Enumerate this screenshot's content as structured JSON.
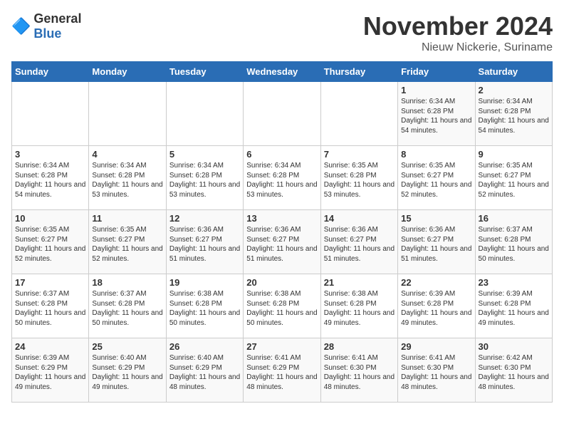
{
  "logo": {
    "text_general": "General",
    "text_blue": "Blue"
  },
  "title": "November 2024",
  "subtitle": "Nieuw Nickerie, Suriname",
  "days_of_week": [
    "Sunday",
    "Monday",
    "Tuesday",
    "Wednesday",
    "Thursday",
    "Friday",
    "Saturday"
  ],
  "weeks": [
    [
      {
        "day": "",
        "detail": ""
      },
      {
        "day": "",
        "detail": ""
      },
      {
        "day": "",
        "detail": ""
      },
      {
        "day": "",
        "detail": ""
      },
      {
        "day": "",
        "detail": ""
      },
      {
        "day": "1",
        "detail": "Sunrise: 6:34 AM\nSunset: 6:28 PM\nDaylight: 11 hours and 54 minutes."
      },
      {
        "day": "2",
        "detail": "Sunrise: 6:34 AM\nSunset: 6:28 PM\nDaylight: 11 hours and 54 minutes."
      }
    ],
    [
      {
        "day": "3",
        "detail": "Sunrise: 6:34 AM\nSunset: 6:28 PM\nDaylight: 11 hours and 54 minutes."
      },
      {
        "day": "4",
        "detail": "Sunrise: 6:34 AM\nSunset: 6:28 PM\nDaylight: 11 hours and 53 minutes."
      },
      {
        "day": "5",
        "detail": "Sunrise: 6:34 AM\nSunset: 6:28 PM\nDaylight: 11 hours and 53 minutes."
      },
      {
        "day": "6",
        "detail": "Sunrise: 6:34 AM\nSunset: 6:28 PM\nDaylight: 11 hours and 53 minutes."
      },
      {
        "day": "7",
        "detail": "Sunrise: 6:35 AM\nSunset: 6:28 PM\nDaylight: 11 hours and 53 minutes."
      },
      {
        "day": "8",
        "detail": "Sunrise: 6:35 AM\nSunset: 6:27 PM\nDaylight: 11 hours and 52 minutes."
      },
      {
        "day": "9",
        "detail": "Sunrise: 6:35 AM\nSunset: 6:27 PM\nDaylight: 11 hours and 52 minutes."
      }
    ],
    [
      {
        "day": "10",
        "detail": "Sunrise: 6:35 AM\nSunset: 6:27 PM\nDaylight: 11 hours and 52 minutes."
      },
      {
        "day": "11",
        "detail": "Sunrise: 6:35 AM\nSunset: 6:27 PM\nDaylight: 11 hours and 52 minutes."
      },
      {
        "day": "12",
        "detail": "Sunrise: 6:36 AM\nSunset: 6:27 PM\nDaylight: 11 hours and 51 minutes."
      },
      {
        "day": "13",
        "detail": "Sunrise: 6:36 AM\nSunset: 6:27 PM\nDaylight: 11 hours and 51 minutes."
      },
      {
        "day": "14",
        "detail": "Sunrise: 6:36 AM\nSunset: 6:27 PM\nDaylight: 11 hours and 51 minutes."
      },
      {
        "day": "15",
        "detail": "Sunrise: 6:36 AM\nSunset: 6:27 PM\nDaylight: 11 hours and 51 minutes."
      },
      {
        "day": "16",
        "detail": "Sunrise: 6:37 AM\nSunset: 6:28 PM\nDaylight: 11 hours and 50 minutes."
      }
    ],
    [
      {
        "day": "17",
        "detail": "Sunrise: 6:37 AM\nSunset: 6:28 PM\nDaylight: 11 hours and 50 minutes."
      },
      {
        "day": "18",
        "detail": "Sunrise: 6:37 AM\nSunset: 6:28 PM\nDaylight: 11 hours and 50 minutes."
      },
      {
        "day": "19",
        "detail": "Sunrise: 6:38 AM\nSunset: 6:28 PM\nDaylight: 11 hours and 50 minutes."
      },
      {
        "day": "20",
        "detail": "Sunrise: 6:38 AM\nSunset: 6:28 PM\nDaylight: 11 hours and 50 minutes."
      },
      {
        "day": "21",
        "detail": "Sunrise: 6:38 AM\nSunset: 6:28 PM\nDaylight: 11 hours and 49 minutes."
      },
      {
        "day": "22",
        "detail": "Sunrise: 6:39 AM\nSunset: 6:28 PM\nDaylight: 11 hours and 49 minutes."
      },
      {
        "day": "23",
        "detail": "Sunrise: 6:39 AM\nSunset: 6:28 PM\nDaylight: 11 hours and 49 minutes."
      }
    ],
    [
      {
        "day": "24",
        "detail": "Sunrise: 6:39 AM\nSunset: 6:29 PM\nDaylight: 11 hours and 49 minutes."
      },
      {
        "day": "25",
        "detail": "Sunrise: 6:40 AM\nSunset: 6:29 PM\nDaylight: 11 hours and 49 minutes."
      },
      {
        "day": "26",
        "detail": "Sunrise: 6:40 AM\nSunset: 6:29 PM\nDaylight: 11 hours and 48 minutes."
      },
      {
        "day": "27",
        "detail": "Sunrise: 6:41 AM\nSunset: 6:29 PM\nDaylight: 11 hours and 48 minutes."
      },
      {
        "day": "28",
        "detail": "Sunrise: 6:41 AM\nSunset: 6:30 PM\nDaylight: 11 hours and 48 minutes."
      },
      {
        "day": "29",
        "detail": "Sunrise: 6:41 AM\nSunset: 6:30 PM\nDaylight: 11 hours and 48 minutes."
      },
      {
        "day": "30",
        "detail": "Sunrise: 6:42 AM\nSunset: 6:30 PM\nDaylight: 11 hours and 48 minutes."
      }
    ]
  ]
}
